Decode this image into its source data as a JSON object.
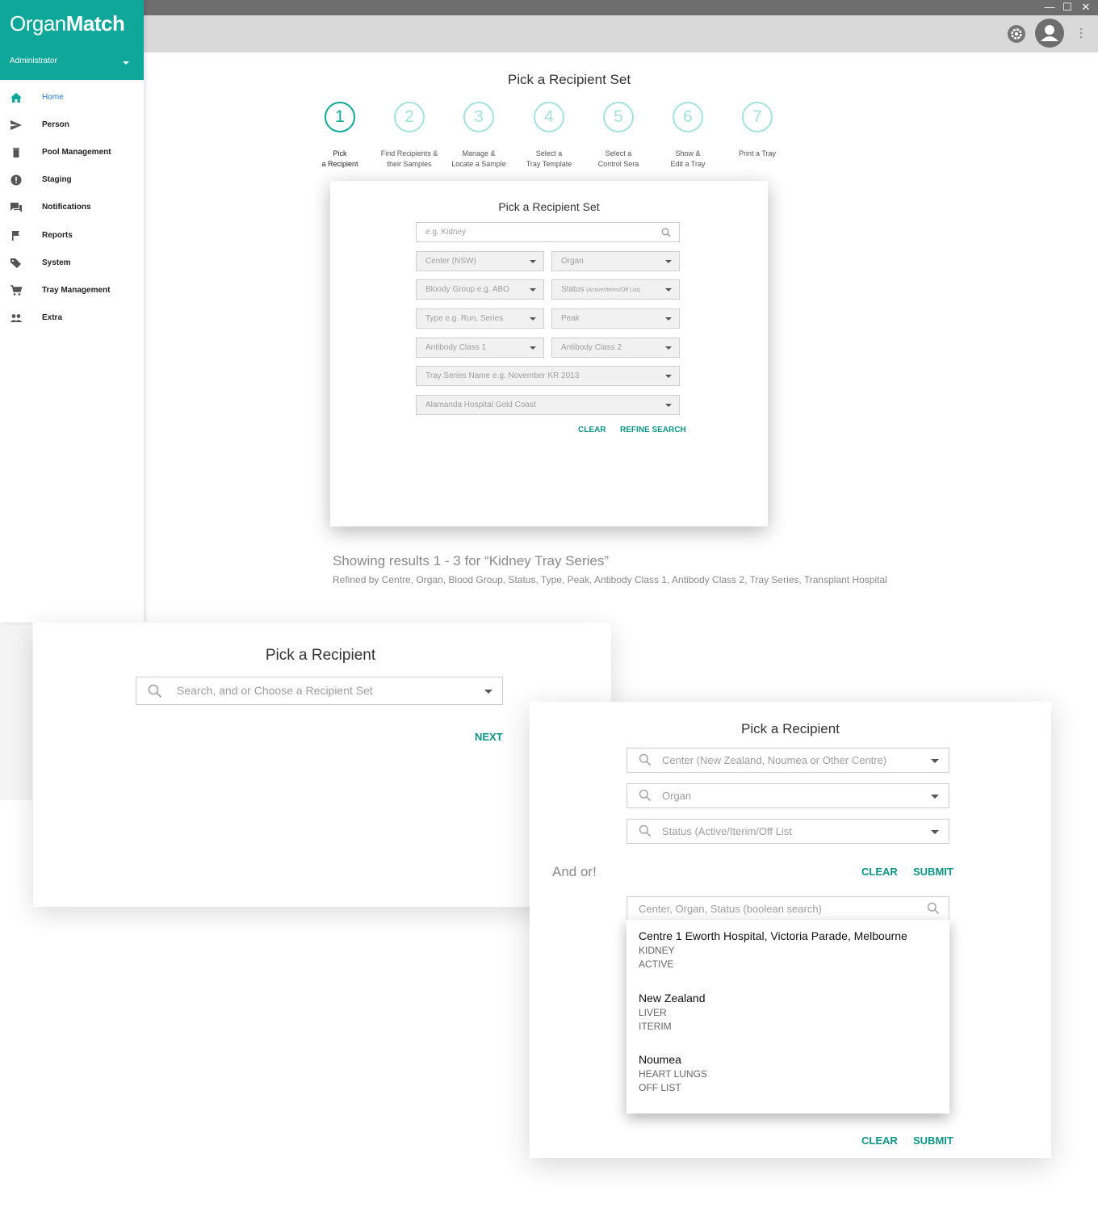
{
  "app": {
    "logo_light": "Organ",
    "logo_bold": "Match",
    "role": "Administrator"
  },
  "window_controls": {
    "minimize": "—",
    "maximize": "☐",
    "close": "✕"
  },
  "topbar": {
    "settings_icon": "gear-icon",
    "avatar_icon": "user-icon",
    "more_icon": "more-vert-icon"
  },
  "sidebar": {
    "items": [
      {
        "label": "Home",
        "icon": "home-icon",
        "active": true
      },
      {
        "label": "Person",
        "icon": "send-icon"
      },
      {
        "label": "Pool Management",
        "icon": "trash-icon"
      },
      {
        "label": "Staging",
        "icon": "alert-icon"
      },
      {
        "label": "Notifications",
        "icon": "chat-icon"
      },
      {
        "label": "Reports",
        "icon": "flag-icon"
      },
      {
        "label": "System",
        "icon": "tag-icon"
      },
      {
        "label": "Tray Management",
        "icon": "cart-icon"
      },
      {
        "label": "Extra",
        "icon": "people-icon"
      }
    ]
  },
  "stepper": {
    "title": "Pick a Recipient Set",
    "steps": [
      {
        "num": "1",
        "line1": "Pick",
        "line2": "a Recipient"
      },
      {
        "num": "2",
        "line1": "Find Recipients &",
        "line2": "their Samples"
      },
      {
        "num": "3",
        "line1": "Manage &",
        "line2": "Locate a Sample"
      },
      {
        "num": "4",
        "line1": "Select a",
        "line2": "Tray Template"
      },
      {
        "num": "5",
        "line1": "Select a",
        "line2": "Control Sera"
      },
      {
        "num": "6",
        "line1": "Show &",
        "line2": "Edit a Tray"
      },
      {
        "num": "7",
        "line1": "Print a Tray",
        "line2": ""
      }
    ]
  },
  "filter_card": {
    "title": "Pick a Recipient Set",
    "search_placeholder": "e.g. Kidney",
    "center": "Center (NSW)",
    "organ": "Organ",
    "blood_group": "Bloody Group e.g. ABO",
    "status_main": "Status",
    "status_small": "(Active/Iterim/Off List)",
    "type": "Type e.g. Run, Series",
    "peak": "Peak",
    "antibody1": "Antibody Class 1",
    "antibody2": "Antibody Class 2",
    "tray_series": "Tray Series Name e.g. November KR 2013",
    "hospital": "Alamanda Hospital Gold Coast",
    "clear": "CLEAR",
    "refine": "REFINE SEARCH"
  },
  "results": {
    "summary": "Showing results 1 - 3 for “Kidney Tray Series”",
    "refined": "Refined by Centre, Organ, Blood Group, Status, Type, Peak, Antibody Class 1, Antibody Class 2, Tray Series, Transplant Hospital"
  },
  "card_simple": {
    "title": "Pick a Recipient",
    "placeholder": "Search, and or Choose a Recipient Set",
    "next": "NEXT"
  },
  "card_advanced": {
    "title": "Pick a Recipient",
    "center": "Center (New Zealand, Noumea or Other Centre)",
    "organ": "Organ",
    "status": "Status (Active/Iterim/Off List",
    "and_or": "And or!",
    "clear": "CLEAR",
    "submit": "SUBMIT",
    "boolean_placeholder": "Center, Organ, Status (boolean search)",
    "options": [
      {
        "title": "Centre 1 Eworth Hospital, Victoria Parade, Melbourne",
        "organ": "KIDNEY",
        "status": "ACTIVE"
      },
      {
        "title": "New Zealand",
        "organ": "LIVER",
        "status": "ITERIM"
      },
      {
        "title": "Noumea",
        "organ": "HEART LUNGS",
        "status": "OFF LIST"
      }
    ],
    "clear_bottom": "CLEAR",
    "submit_bottom": "SUBMIT"
  },
  "colors": {
    "brand": "#0ea79a",
    "link": "#0d9488",
    "active_nav": "#2a7ad6"
  }
}
